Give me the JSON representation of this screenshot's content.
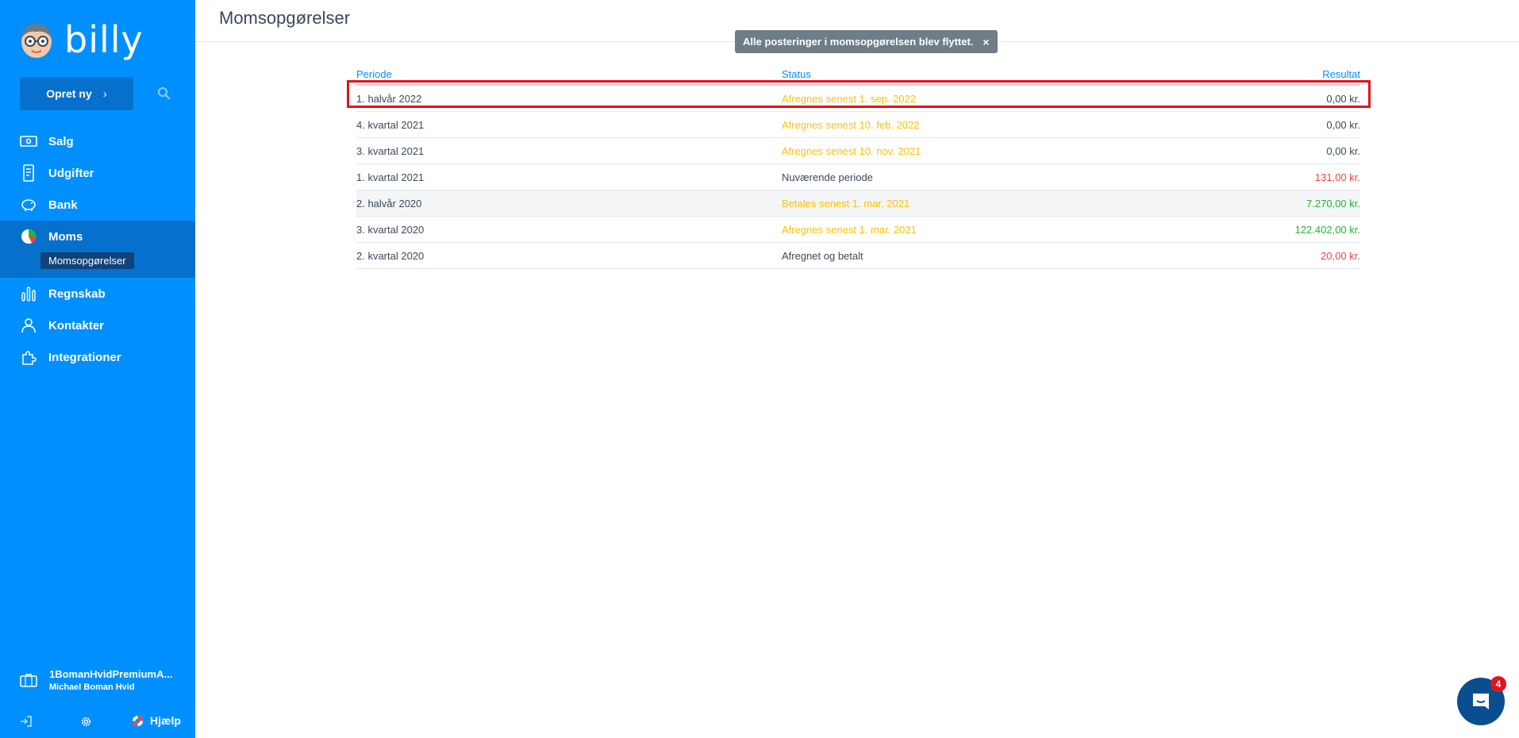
{
  "sidebar": {
    "brand": "billy",
    "create_label": "Opret ny",
    "nav": [
      {
        "label": "Salg",
        "icon": "money-icon"
      },
      {
        "label": "Udgifter",
        "icon": "receipt-icon"
      },
      {
        "label": "Bank",
        "icon": "piggy-bank-icon"
      },
      {
        "label": "Moms",
        "icon": "pie-chart-icon"
      },
      {
        "label": "Regnskab",
        "icon": "bar-chart-icon"
      },
      {
        "label": "Kontakter",
        "icon": "person-icon"
      },
      {
        "label": "Integrationer",
        "icon": "puzzle-icon"
      }
    ],
    "sub_item": "Momsopgørelser",
    "account_name": "1BomanHvidPremiumA...",
    "account_user": "Michael Boman Hvid",
    "help_label": "Hjælp"
  },
  "main": {
    "title": "Momsopgørelser",
    "toast": "Alle posteringer i momsopgørelsen blev flyttet.",
    "toast_close": "×",
    "columns": {
      "period": "Periode",
      "status": "Status",
      "result": "Resultat"
    },
    "rows": [
      {
        "period": "1. halvår 2022",
        "status": "Afregnes senest 1. sep. 2022",
        "result": "0,00 kr."
      },
      {
        "period": "4. kvartal 2021",
        "status": "Afregnes senest 10. feb. 2022",
        "result": "0,00 kr."
      },
      {
        "period": "3. kvartal 2021",
        "status": "Afregnes senest 10. nov. 2021",
        "result": "0,00 kr."
      },
      {
        "period": "1. kvartal 2021",
        "status": "Nuværende periode",
        "result": "131,00 kr."
      },
      {
        "period": "2. halvår 2020",
        "status": "Betales senest 1. mar. 2021",
        "result": "7.270,00 kr."
      },
      {
        "period": "3. kvartal 2020",
        "status": "Afregnes senest 1. mar. 2021",
        "result": "122.402,00 kr."
      },
      {
        "period": "2. kvartal 2020",
        "status": "Afregnet og betalt",
        "result": "20,00 kr."
      }
    ]
  },
  "chat": {
    "badge": "4"
  },
  "colors": {
    "sidebar": "#008fff",
    "warning": "#ffc200",
    "negative": "#ff3d3d",
    "positive": "#1fba2f",
    "highlight": "#e0141b"
  }
}
